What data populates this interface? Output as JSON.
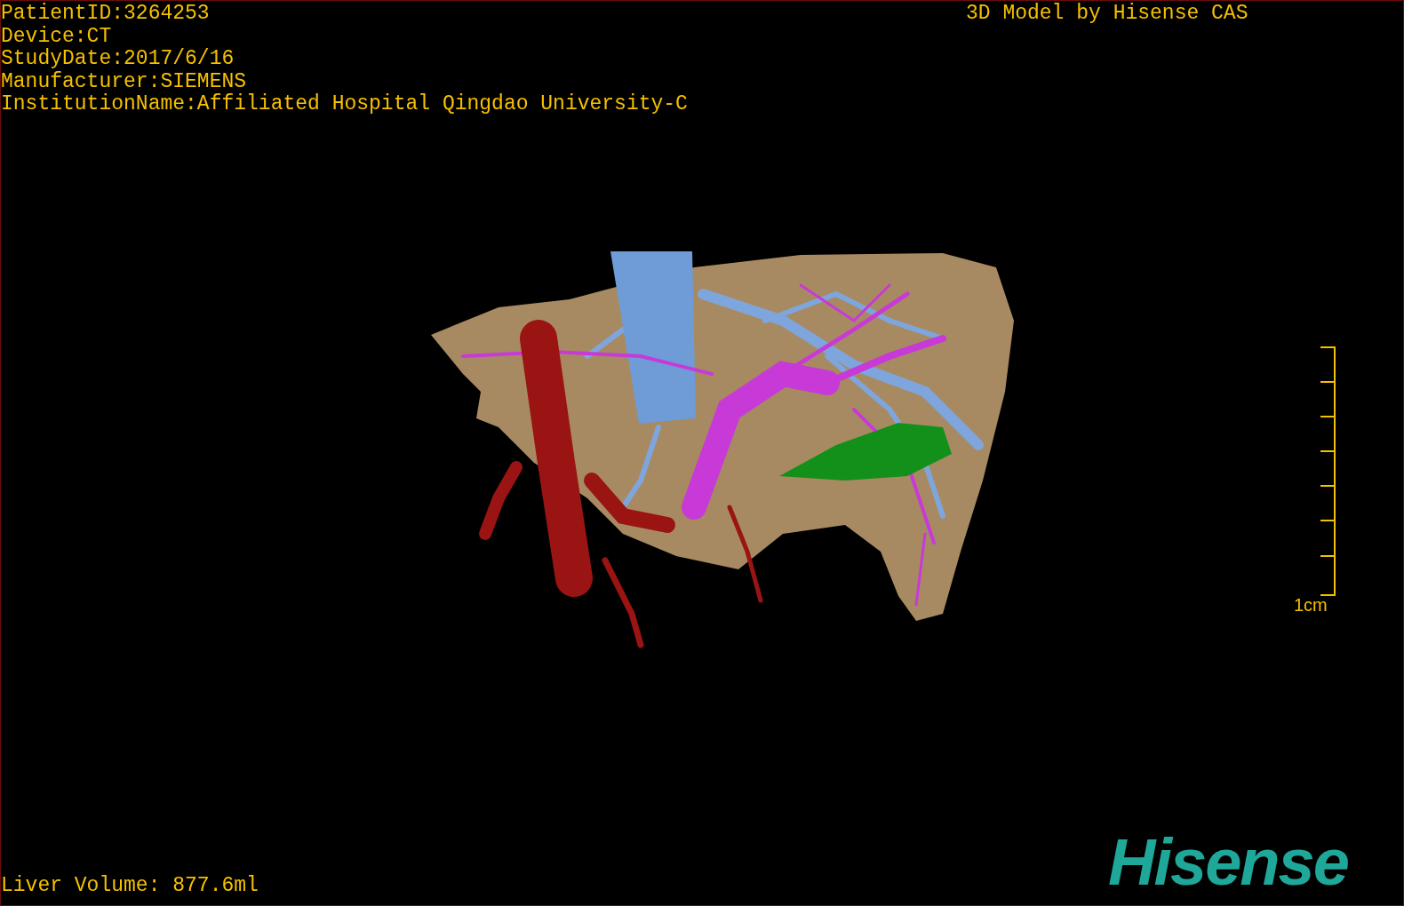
{
  "patient_info": [
    "PatientID:3264253",
    "Device:CT",
    "StudyDate:2017/6/16",
    "Manufacturer:SIEMENS",
    "InstitutionName:Affiliated Hospital Qingdao University-C"
  ],
  "model_credit": "3D Model by Hisense CAS",
  "scale_bar": {
    "label": "1cm"
  },
  "liver_volume": "Liver Volume: 877.6ml",
  "logo": {
    "text": "Hisense"
  }
}
